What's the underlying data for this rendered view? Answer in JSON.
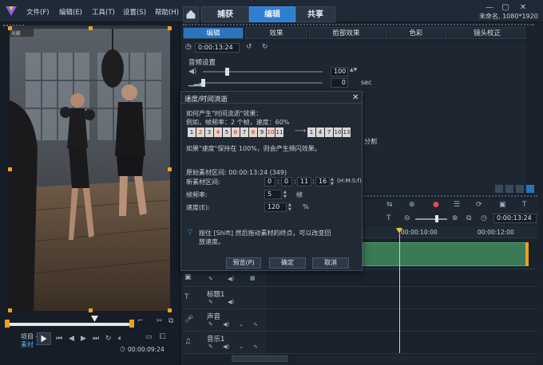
{
  "menu": {
    "file": "文件(F)",
    "edit": "编辑(E)",
    "tools": "工具(T)",
    "settings": "设置(S)",
    "help": "帮助(H)"
  },
  "top_tabs": {
    "capture": "捕获",
    "edit": "编辑",
    "share": "共享"
  },
  "project_info": "未命名, 1080*1920",
  "subtabs": {
    "edit": "编辑",
    "effect": "效果",
    "face": "脸部效果",
    "color": "色彩",
    "lens": "镜头校正"
  },
  "options": {
    "duration": "0:00:13:24",
    "audio_settings": "音频设置",
    "volume": "100",
    "fade_val": "0",
    "sec": "sec",
    "split": "分割"
  },
  "timeline": {
    "time1": "0:00:13:24",
    "mark1": "00:00:10:00",
    "mark2": "00:00:12:00",
    "tracks": [
      {
        "label": "标题1"
      },
      {
        "label": "声音"
      },
      {
        "label": "音乐1"
      }
    ]
  },
  "preview": {
    "badge": "光影",
    "project": "项目 -",
    "clip": "素材 -",
    "timecode": "00:00:09:24"
  },
  "dialog": {
    "title": "速度/时间流逝",
    "line1": "如何产生\"时间流逝\"效果：",
    "line2": "例如，帧频率：2 个帧，速度：60%",
    "frames_in": [
      "1",
      "2",
      "3",
      "4",
      "5",
      "6",
      "7",
      "8",
      "9",
      "10",
      "11"
    ],
    "frames_out": [
      "1",
      "4",
      "7",
      "10",
      "13"
    ],
    "line3": "如果\"速度\"保持在 100%，则会产生频闪效果。",
    "orig_label": "原始素材区间: 00:00:13:24 (349)",
    "new_label": "新素材区间:",
    "nv1": "0",
    "nv2": "0",
    "nv3": "11",
    "nv4": "16",
    "hms": "(H:M:S:f)",
    "fr_label": "帧频率:",
    "fr_val": "5",
    "fr_unit": "帧",
    "speed_label": "速度(E):",
    "speed_val": "120",
    "speed_unit": "%",
    "tip1": "按住 [Shift] 然后拖动素材的终点，可以改变回",
    "tip2": "放速度。",
    "btn_preview": "预览(P)",
    "btn_ok": "确定",
    "btn_cancel": "取消"
  },
  "colors": {
    "accent": "#2f7fd0",
    "handle": "#f0a020",
    "clip": "#3a7a55"
  }
}
